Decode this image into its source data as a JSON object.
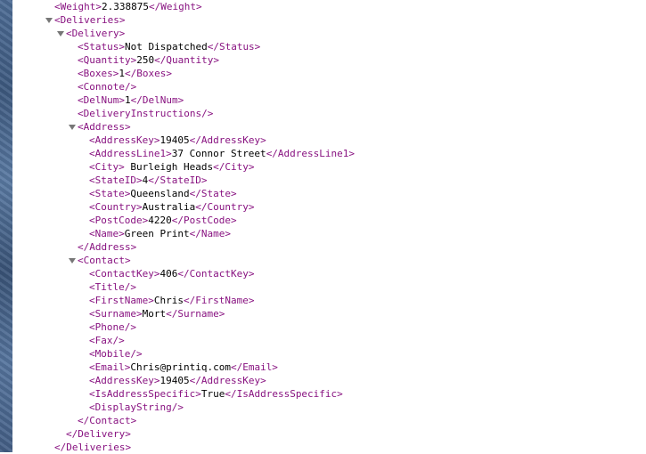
{
  "xml": [
    {
      "indent": 0,
      "open": "<Weight>",
      "text": "2.338875",
      "close": "</Weight>"
    },
    {
      "indent": 0,
      "open": "<Deliveries>",
      "arrow": true
    },
    {
      "indent": 1,
      "open": "<Delivery>",
      "arrow": true
    },
    {
      "indent": 2,
      "open": "<Status>",
      "text": "Not Dispatched",
      "close": "</Status>"
    },
    {
      "indent": 2,
      "open": "<Quantity>",
      "text": "250",
      "close": "</Quantity>"
    },
    {
      "indent": 2,
      "open": "<Boxes>",
      "text": "1",
      "close": "</Boxes>"
    },
    {
      "indent": 2,
      "open": "<Connote/>"
    },
    {
      "indent": 2,
      "open": "<DelNum>",
      "text": "1",
      "close": "</DelNum>"
    },
    {
      "indent": 2,
      "open": "<DeliveryInstructions/>"
    },
    {
      "indent": 2,
      "open": "<Address>",
      "arrow": true
    },
    {
      "indent": 3,
      "open": "<AddressKey>",
      "text": "19405",
      "close": "</AddressKey>"
    },
    {
      "indent": 3,
      "open": "<AddressLine1>",
      "text": "37 Connor Street",
      "close": "</AddressLine1>"
    },
    {
      "indent": 3,
      "open": "<City>",
      "text": " Burleigh Heads",
      "close": "</City>"
    },
    {
      "indent": 3,
      "open": "<StateID>",
      "text": "4",
      "close": "</StateID>"
    },
    {
      "indent": 3,
      "open": "<State>",
      "text": "Queensland",
      "close": "</State>"
    },
    {
      "indent": 3,
      "open": "<Country>",
      "text": "Australia",
      "close": "</Country>"
    },
    {
      "indent": 3,
      "open": "<PostCode>",
      "text": "4220",
      "close": "</PostCode>"
    },
    {
      "indent": 3,
      "open": "<Name>",
      "text": "Green Print",
      "close": "</Name>"
    },
    {
      "indent": 2,
      "open": "</Address>"
    },
    {
      "indent": 2,
      "open": "<Contact>",
      "arrow": true
    },
    {
      "indent": 3,
      "open": "<ContactKey>",
      "text": "406",
      "close": "</ContactKey>"
    },
    {
      "indent": 3,
      "open": "<Title/>"
    },
    {
      "indent": 3,
      "open": "<FirstName>",
      "text": "Chris",
      "close": "</FirstName>"
    },
    {
      "indent": 3,
      "open": "<Surname>",
      "text": "Mort",
      "close": "</Surname>"
    },
    {
      "indent": 3,
      "open": "<Phone/>"
    },
    {
      "indent": 3,
      "open": "<Fax/>"
    },
    {
      "indent": 3,
      "open": "<Mobile/>"
    },
    {
      "indent": 3,
      "open": "<Email>",
      "text": "Chris@printiq.com",
      "close": "</Email>"
    },
    {
      "indent": 3,
      "open": "<AddressKey>",
      "text": "19405",
      "close": "</AddressKey>"
    },
    {
      "indent": 3,
      "open": "<IsAddressSpecific>",
      "text": "True",
      "close": "</IsAddressSpecific>"
    },
    {
      "indent": 3,
      "open": "<DisplayString/>"
    },
    {
      "indent": 2,
      "open": "</Contact>"
    },
    {
      "indent": 1,
      "open": "</Delivery>"
    },
    {
      "indent": 0,
      "open": "</Deliveries>"
    }
  ],
  "colors": {
    "tag": "#881280",
    "text": "#000000",
    "arrow": "#777777"
  },
  "icons": {
    "expand_arrow": "disclosure-triangle-icon"
  }
}
